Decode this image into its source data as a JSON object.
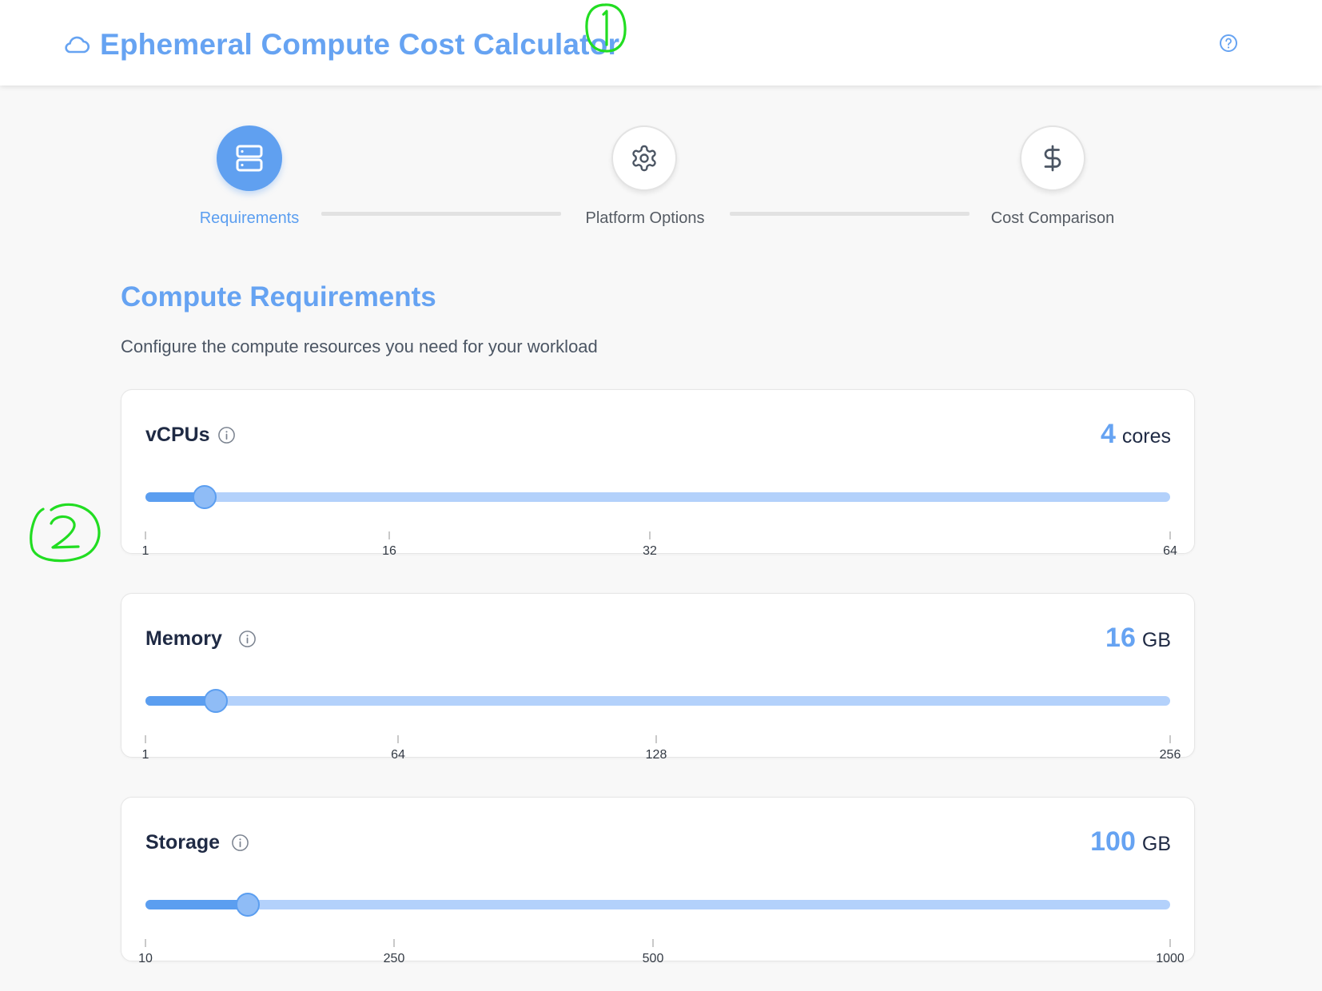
{
  "header": {
    "title": "Ephemeral Compute Cost Calculator",
    "logo_icon": "cloud-icon",
    "help_icon": "help-circle-icon"
  },
  "stepper": {
    "steps": [
      {
        "label": "Requirements",
        "icon": "server-icon",
        "active": true
      },
      {
        "label": "Platform Options",
        "icon": "gear-icon",
        "active": false
      },
      {
        "label": "Cost Comparison",
        "icon": "dollar-icon",
        "active": false
      }
    ]
  },
  "section": {
    "title": "Compute Requirements",
    "description": "Configure the compute resources you need for your workload"
  },
  "resources": [
    {
      "label": "vCPUs",
      "value": "4",
      "unit": "cores",
      "min": 1,
      "max": 64,
      "slider_fraction": 0.058,
      "ticks": [
        "1",
        "16",
        "32",
        "64"
      ]
    },
    {
      "label": "Memory",
      "value": "16",
      "unit": "GB",
      "min": 1,
      "max": 256,
      "slider_fraction": 0.069,
      "ticks": [
        "1",
        "64",
        "128",
        "256"
      ]
    },
    {
      "label": "Storage",
      "value": "100",
      "unit": "GB",
      "min": 10,
      "max": 1000,
      "slider_fraction": 0.1,
      "ticks": [
        "10",
        "250",
        "500",
        "1000"
      ]
    }
  ],
  "annotations": [
    "1",
    "2"
  ],
  "colors": {
    "accent": "#5b9ef0",
    "accent_light": "#b3d1fb",
    "annotation": "#22dd22"
  }
}
